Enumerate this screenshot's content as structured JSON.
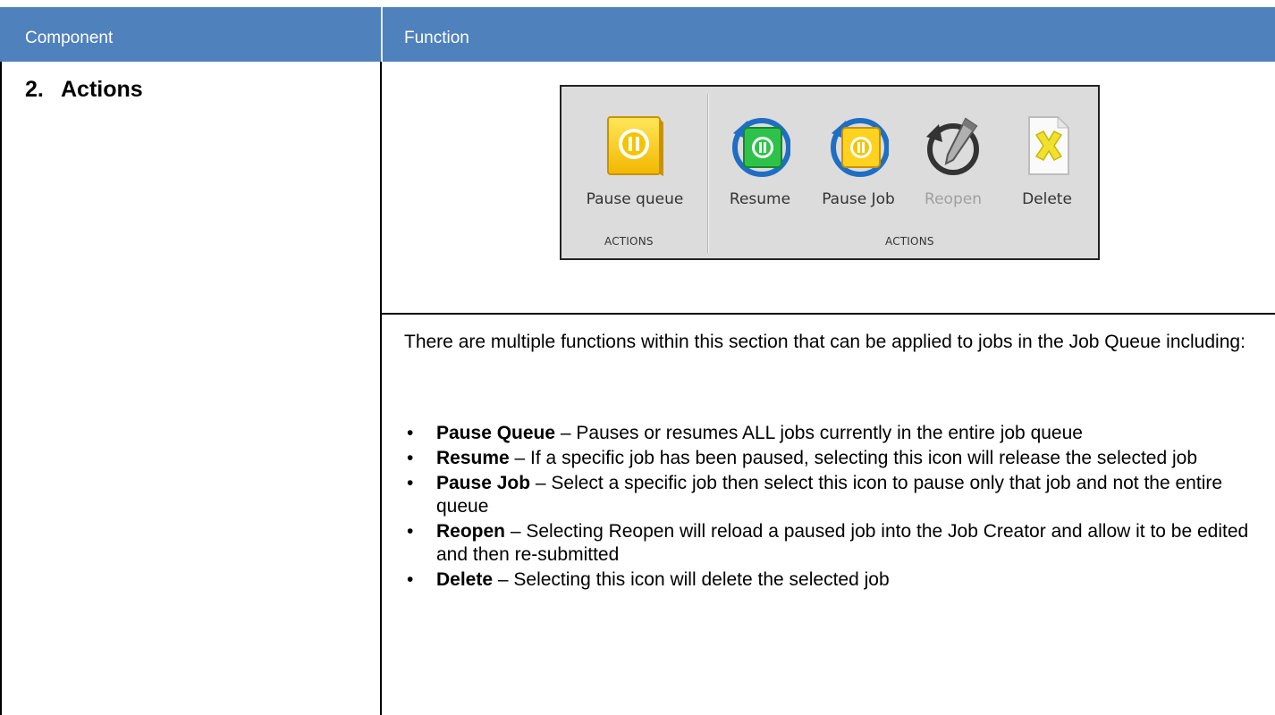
{
  "table": {
    "header": {
      "component": "Component",
      "function": "Function"
    },
    "row": {
      "number": "2.",
      "title": "Actions"
    }
  },
  "ribbon": {
    "group1": {
      "button": "Pause queue",
      "label": "ACTIONS"
    },
    "group2": {
      "buttons": [
        "Resume",
        "Pause Job",
        "Reopen",
        "Delete"
      ],
      "label": "ACTIONS"
    },
    "disabled_button": "Reopen"
  },
  "description": {
    "intro": "There are multiple functions within this section that can be applied to jobs in the Job Queue including:",
    "bullets": [
      {
        "term": "Pause Queue",
        "text": " – Pauses or resumes ALL jobs currently in the entire job queue"
      },
      {
        "term": "Resume",
        "text": " – If a specific job has been paused, selecting this icon will release the selected job"
      },
      {
        "term": "Pause Job",
        "text": " – Select a specific job then select this icon to pause only that job and not the entire queue"
      },
      {
        "term": "Reopen",
        "text": " – Selecting Reopen will reload a paused job into the Job Creator and allow it to be edited and then re-submitted"
      },
      {
        "term": "Delete",
        "text": " – Selecting this icon will delete the selected job"
      }
    ]
  },
  "colors": {
    "header_bg": "#4f81bd",
    "ribbon_bg": "#dcdcdc"
  }
}
